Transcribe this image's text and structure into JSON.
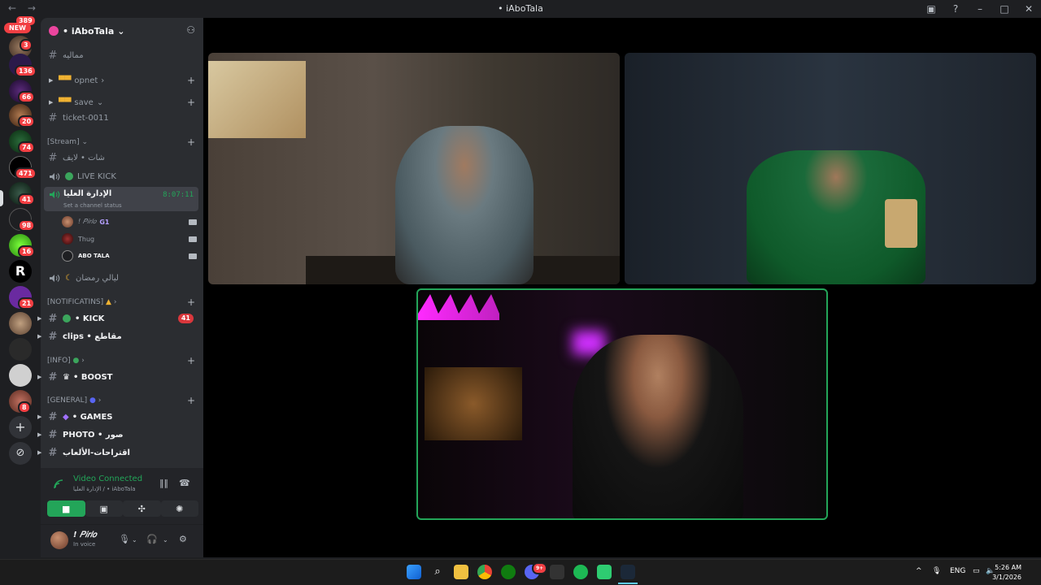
{
  "window": {
    "title": "• iAboTala",
    "nav_back": "←",
    "nav_forward": "→"
  },
  "rail": {
    "new_label": "NEW",
    "top_badge": "389",
    "badges": [
      "3",
      "136",
      "66",
      "20",
      "74",
      "471",
      "41",
      "98",
      "16",
      "21",
      "8"
    ],
    "add_server": "+",
    "explore": "⊘"
  },
  "server": {
    "name": "• iAboTala",
    "chevron": "⌄",
    "add_member_icon": "add-member-icon"
  },
  "channels": {
    "c1": "مماليه",
    "opnet": "opnet",
    "save": "save",
    "ticket": "ticket-0011",
    "cat_stream": "[Stream]",
    "live_chat": "شات • لايف",
    "live_kick": "LIVE KICK",
    "active_vc": {
      "name": "الإدارة العليا",
      "status": "Set a channel status",
      "timer": "8:07:11"
    },
    "members": [
      {
        "name": "! 𝑃𝑖𝑟𝑙𝑜",
        "tag": "G1"
      },
      {
        "name": "Thug",
        "tag": ""
      },
      {
        "name": "ABO TALA",
        "tag": ""
      }
    ],
    "ramadan": "ليالي رمضان",
    "cat_notif": "[NOTIFICATINS]",
    "kick": "• KICK",
    "kick_count": "41",
    "clips": "clips • مقاطع",
    "cat_info": "[INFO]",
    "boost": "• BOOST",
    "cat_general": "[GENERAL]",
    "games": "• GAMES",
    "photo": "PHOTO • صور",
    "suggest": "اقتراحات-الألعاب"
  },
  "voice_panel": {
    "status": "Video Connected",
    "sub": "الإدارة العليا / • iAboTala"
  },
  "user_panel": {
    "name": "! 𝑃𝑖𝑟𝑙𝑜",
    "status": "In voice"
  },
  "stage": {
    "tile1": "poster-bedroom-tile",
    "tile2": "green-hoodie-tile",
    "tile3": "neon-room-tile"
  },
  "taskbar": {
    "lang": "ENG",
    "time": "5:26 AM",
    "date": "3/1/2026",
    "discord_badge": "9+"
  },
  "colors": {
    "accent_green": "#23a559",
    "badge_red": "#f23f43",
    "speaking_border": "#23a559"
  }
}
